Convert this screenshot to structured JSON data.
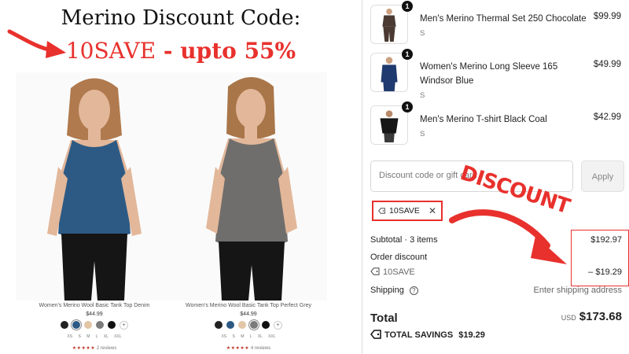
{
  "promo": {
    "headline": "Merino Discount Code:",
    "code": "10SAVE",
    "offer": " - upto 55%"
  },
  "products": [
    {
      "title": "Women's Merino Wool Basic Tank Top Denim",
      "price": "$44.99",
      "sizes": "XS S M L XL XXL",
      "stars": "★★★★★",
      "reviews": "2 reviews",
      "swatches": [
        "#222222",
        "#2d5a85",
        "#e2c6a6",
        "#7b7b7b",
        "#111111"
      ],
      "selected_swatch": 1
    },
    {
      "title": "Women's Merino Wool Basic Tank Top Perfect Grey",
      "price": "$44.99",
      "sizes": "XS S M L XL XXL",
      "stars": "★★★★★",
      "reviews": "4 reviews",
      "swatches": [
        "#222222",
        "#2d5a85",
        "#e2c6a6",
        "#7b7b7b",
        "#111111"
      ],
      "selected_swatch": 3
    }
  ],
  "cart": {
    "items": [
      {
        "qty": "1",
        "name": "Men's Merino Thermal Set 250 Chocolate",
        "variant": "S",
        "price": "$99.99",
        "color": "#4a3a32"
      },
      {
        "qty": "1",
        "name": "Women's Merino Long Sleeve 165 Windsor Blue",
        "variant": "S",
        "price": "$49.99",
        "color": "#1f3a6e"
      },
      {
        "qty": "1",
        "name": "Men's Merino T-shirt Black Coal",
        "variant": "S",
        "price": "$42.99",
        "color": "#161616"
      }
    ],
    "discount_placeholder": "Discount code or gift card",
    "apply_label": "Apply",
    "applied_code": "10SAVE",
    "subtotal_label": "Subtotal · 3 items",
    "subtotal_value": "$192.97",
    "order_discount_label": "Order discount",
    "discount_code_line": "10SAVE",
    "discount_value": "– $19.29",
    "shipping_label": "Shipping",
    "shipping_value": "Enter shipping address",
    "total_label": "Total",
    "currency": "USD",
    "total_value": "$173.68",
    "savings_label": "TOTAL SAVINGS",
    "savings_value": "$19.29"
  },
  "annotation": {
    "word": "DISCOUNT",
    "color": "#e8302c"
  }
}
